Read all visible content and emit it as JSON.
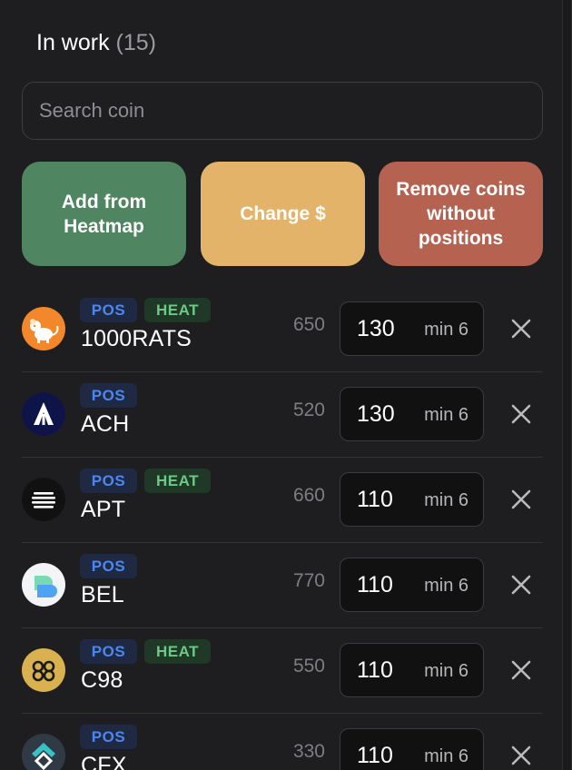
{
  "header": {
    "title": "In work",
    "count": "(15)"
  },
  "search": {
    "placeholder": "Search coin"
  },
  "actions": {
    "add_label": "Add from Heatmap",
    "change_label": "Change $",
    "remove_label": "Remove coins without positions"
  },
  "badges": {
    "pos": "POS",
    "heat": "HEAT"
  },
  "coins": [
    {
      "symbol": "1000RATS",
      "amount": "650",
      "value": "130",
      "min": "min 6",
      "pos": true,
      "heat": true,
      "icon": "rat-icon",
      "icon_color": "#f2882b"
    },
    {
      "symbol": "ACH",
      "amount": "520",
      "value": "130",
      "min": "min 6",
      "pos": true,
      "heat": false,
      "icon": "alchemy-icon",
      "icon_color": "#0f1448"
    },
    {
      "symbol": "APT",
      "amount": "660",
      "value": "110",
      "min": "min 6",
      "pos": true,
      "heat": true,
      "icon": "aptos-icon",
      "icon_color": "#111111"
    },
    {
      "symbol": "BEL",
      "amount": "770",
      "value": "110",
      "min": "min 6",
      "pos": true,
      "heat": false,
      "icon": "bella-icon",
      "icon_color": "#f2f4f7"
    },
    {
      "symbol": "C98",
      "amount": "550",
      "value": "110",
      "min": "min 6",
      "pos": true,
      "heat": true,
      "icon": "c98-icon",
      "icon_color": "#d9b24f"
    },
    {
      "symbol": "CFX",
      "amount": "330",
      "value": "110",
      "min": "min 6",
      "pos": true,
      "heat": false,
      "icon": "conflux-icon",
      "icon_color": "#2f3a44"
    }
  ]
}
